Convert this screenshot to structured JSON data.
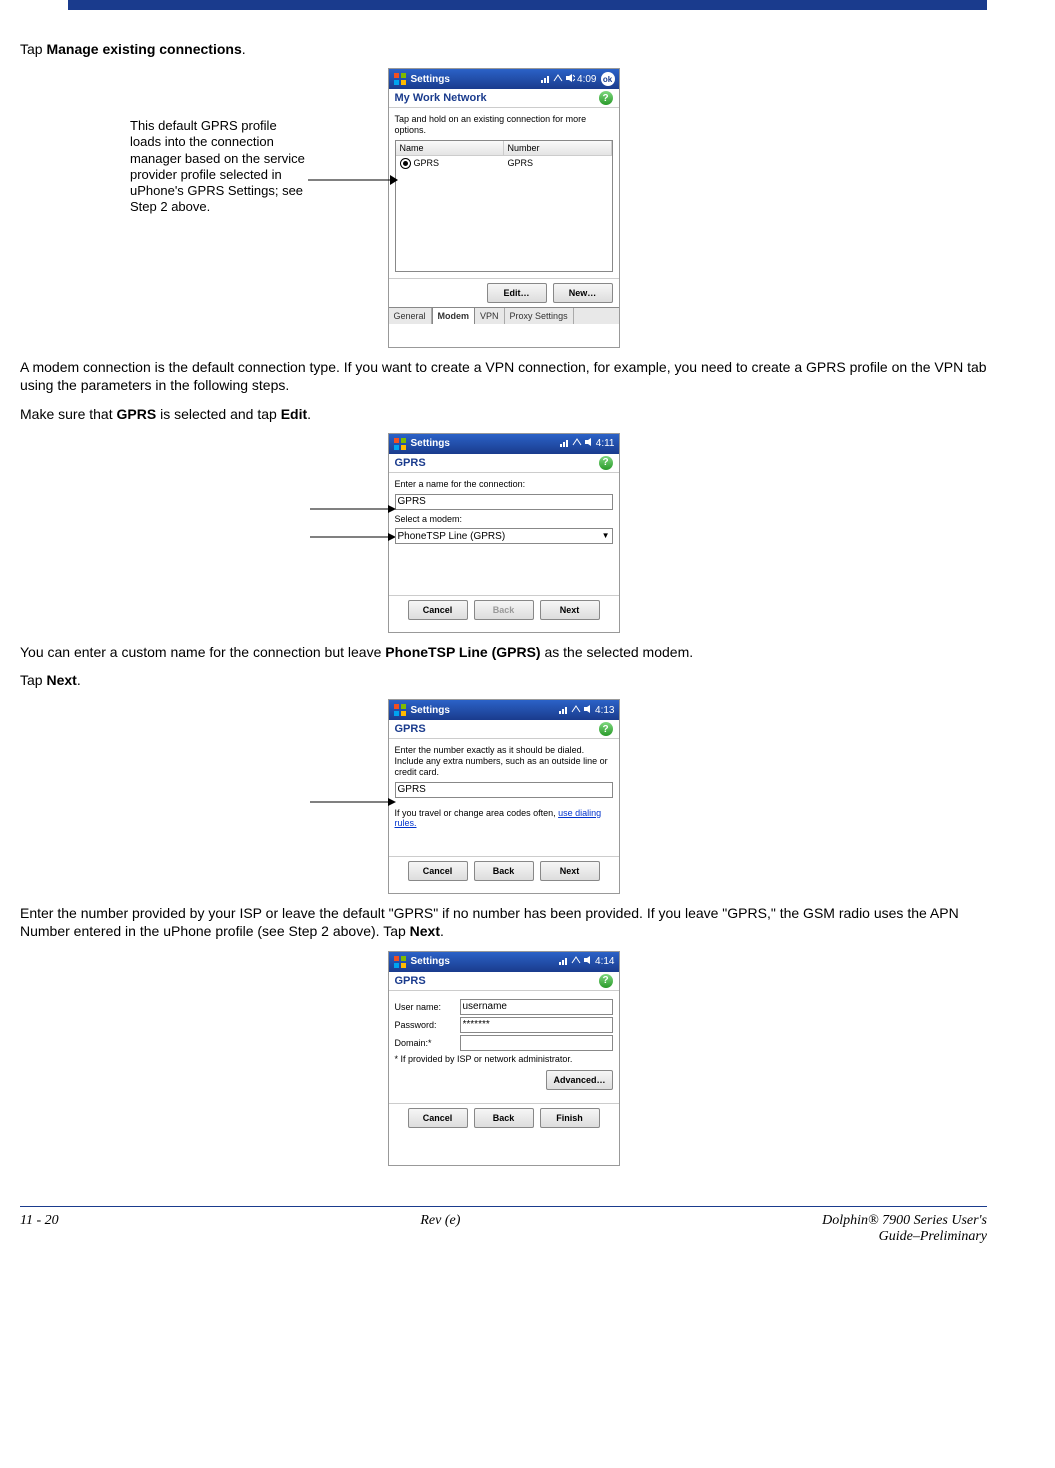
{
  "header_bar_color": "#1a3b8d",
  "text": {
    "p1a": "Tap ",
    "p1b": "Manage existing connections",
    "p1c": ".",
    "callout1": "This default GPRS profile loads into the connection manager based on the service provider profile selected in uPhone's GPRS Settings; see Step 2 above.",
    "p2": "A modem connection is the default connection type. If you want to create a VPN connection, for example, you need to create a GPRS profile on the VPN tab using the parameters in the following steps.",
    "p3a": "Make sure that ",
    "p3b": "GPRS",
    "p3c": " is selected and tap ",
    "p3d": "Edit",
    "p3e": ".",
    "p4a": "You can enter a custom name for the connection but leave ",
    "p4b": "PhoneTSP Line (GPRS)",
    "p4c": " as the selected modem.",
    "p5a": "Tap ",
    "p5b": "Next",
    "p5c": ".",
    "p6a": "Enter the number provided by your ISP or leave the default \"GPRS\" if no number has been provided. If you leave \"GPRS,\" the GSM radio uses the APN Number entered in the uPhone profile (see Step 2 above). Tap ",
    "p6b": "Next",
    "p6c": "."
  },
  "shot1": {
    "title": "Settings",
    "time": "4:09",
    "ok": "ok",
    "subtitle": "My Work Network",
    "hint": "Tap and hold on an existing connection for more options.",
    "col1": "Name",
    "col2": "Number",
    "row_name": "GPRS",
    "row_number": "GPRS",
    "btn_edit": "Edit…",
    "btn_new": "New…",
    "tabs": [
      "General",
      "Modem",
      "VPN",
      "Proxy Settings"
    ]
  },
  "shot2": {
    "title": "Settings",
    "time": "4:11",
    "subtitle": "GPRS",
    "label_name": "Enter a name for the connection:",
    "value_name": "GPRS",
    "label_modem": "Select a modem:",
    "value_modem": "PhoneTSP Line (GPRS)",
    "btn_cancel": "Cancel",
    "btn_back": "Back",
    "btn_next": "Next"
  },
  "shot3": {
    "title": "Settings",
    "time": "4:13",
    "subtitle": "GPRS",
    "hint": "Enter the number exactly as it should be dialed.  Include any extra numbers, such as an outside line or credit card.",
    "value_number": "GPRS",
    "travel_pre": "If you travel or change area codes often, ",
    "travel_link": "use dialing rules.",
    "btn_cancel": "Cancel",
    "btn_back": "Back",
    "btn_next": "Next"
  },
  "shot4": {
    "title": "Settings",
    "time": "4:14",
    "subtitle": "GPRS",
    "lbl_user": "User name:",
    "val_user": "username",
    "lbl_pass": "Password:",
    "val_pass": "*******",
    "lbl_domain": "Domain:*",
    "val_domain": "",
    "note": "* If provided by ISP or network administrator.",
    "btn_adv": "Advanced…",
    "btn_cancel": "Cancel",
    "btn_back": "Back",
    "btn_finish": "Finish"
  },
  "footer": {
    "left": "11 - 20",
    "center": "Rev (e)",
    "right1": "Dolphin® 7900 Series User's",
    "right2": "Guide–Preliminary"
  }
}
